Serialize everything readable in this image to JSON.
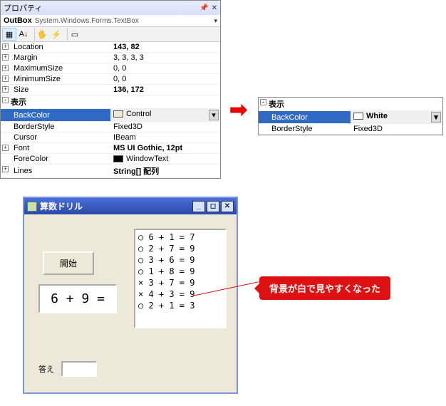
{
  "propPanel": {
    "title": "プロパティ",
    "object_name": "OutBox",
    "object_type": "System.Windows.Forms.TextBox",
    "rows": [
      {
        "exp": "+",
        "name": "Location",
        "val": "143, 82",
        "bold": true
      },
      {
        "exp": "+",
        "name": "Margin",
        "val": "3, 3, 3, 3"
      },
      {
        "exp": "+",
        "name": "MaximumSize",
        "val": "0, 0"
      },
      {
        "exp": "+",
        "name": "MinimumSize",
        "val": "0, 0"
      },
      {
        "exp": "+",
        "name": "Size",
        "val": "136, 172",
        "bold": true
      },
      {
        "exp": "-",
        "name": "表示",
        "val": "",
        "bold": true,
        "header": true
      },
      {
        "exp": "",
        "name": "BackColor",
        "val": "Control",
        "sel": true,
        "swatch": "#ece9d8"
      },
      {
        "exp": "",
        "name": "BorderStyle",
        "val": "Fixed3D"
      },
      {
        "exp": "",
        "name": "Cursor",
        "val": "IBeam"
      },
      {
        "exp": "+",
        "name": "Font",
        "val": "MS UI Gothic, 12pt",
        "bold": true
      },
      {
        "exp": "",
        "name": "ForeColor",
        "val": "WindowText",
        "swatch": "#000000"
      },
      {
        "exp": "+",
        "name": "Lines",
        "val": "String[] 配列",
        "bold": true
      }
    ]
  },
  "propPanel2": {
    "rows": [
      {
        "exp": "-",
        "name": "表示",
        "val": "",
        "bold": true,
        "header": true
      },
      {
        "exp": "",
        "name": "BackColor",
        "val": "White",
        "bold": true,
        "sel": true,
        "swatch": "#ffffff"
      },
      {
        "exp": "",
        "name": "BorderStyle",
        "val": "Fixed3D"
      }
    ]
  },
  "app": {
    "title": "算数ドリル",
    "start_label": "開始",
    "problem": "6 + 9 =",
    "answer_label": "答え",
    "answer_value": "",
    "outbox_lines": [
      "○ 6 + 1 = 7",
      "○ 2 + 7 = 9",
      "○ 3 + 6 = 9",
      "○ 1 + 8 = 9",
      "× 3 + 7 = 9",
      "× 4 + 3 = 9",
      "○ 2 + 1 = 3"
    ]
  },
  "callout_text": "背景が白で見やすくなった"
}
